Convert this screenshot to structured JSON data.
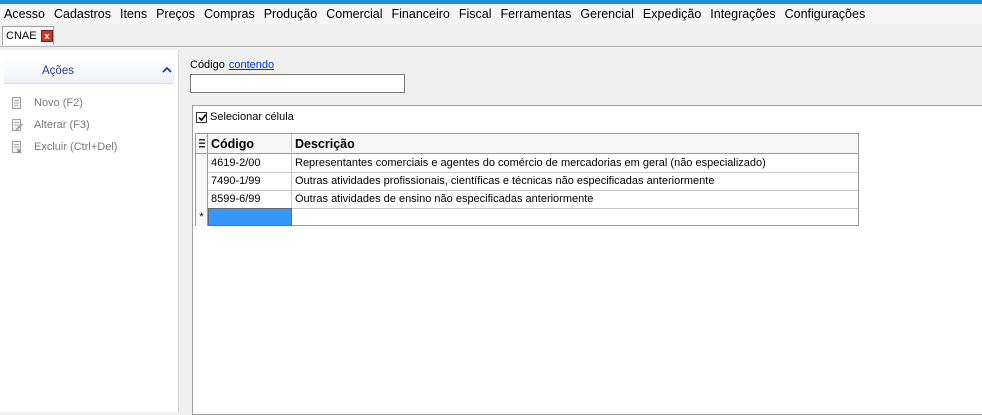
{
  "menu": {
    "items": [
      "Acesso",
      "Cadastros",
      "Itens",
      "Preços",
      "Compras",
      "Produção",
      "Comercial",
      "Financeiro",
      "Fiscal",
      "Ferramentas",
      "Gerencial",
      "Expedição",
      "Integrações",
      "Configurações"
    ]
  },
  "tab": {
    "label": "CNAE",
    "close_glyph": "x"
  },
  "sidebar": {
    "title": "Ações",
    "actions": [
      {
        "label": "Novo (F2)"
      },
      {
        "label": "Alterar (F3)"
      },
      {
        "label": "Excluir (Ctrl+Del)"
      }
    ]
  },
  "filter": {
    "label": "Código",
    "mode_link": "contendo",
    "value": ""
  },
  "grid": {
    "select_cell_label": "Selecionar célula",
    "select_cell_checked": true,
    "columns": [
      "Código",
      "Descrição"
    ],
    "rows": [
      {
        "codigo": "4619-2/00",
        "descricao": "Representantes comerciais e agentes do comércio de mercadorias em geral (não especializado)"
      },
      {
        "codigo": "7490-1/99",
        "descricao": "Outras atividades profissionais, científicas e técnicas não especificadas anteriormente"
      },
      {
        "codigo": "8599-6/99",
        "descricao": "Outras atividades de ensino não especificadas anteriormente"
      }
    ],
    "new_row_marker": "*"
  }
}
